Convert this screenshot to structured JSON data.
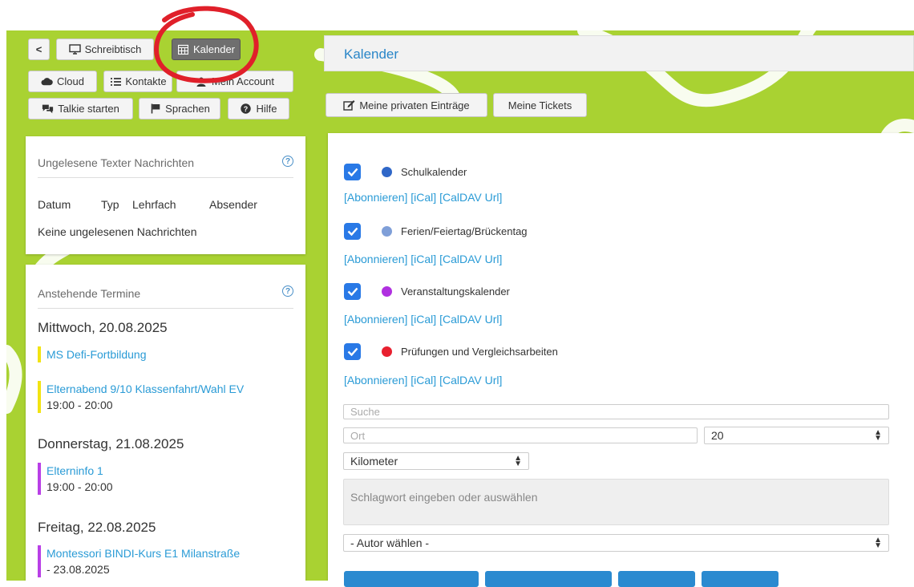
{
  "nav": {
    "back_label": "<",
    "desktop_label": "Schreibtisch",
    "calendar_label": "Kalender",
    "cloud_label": "Cloud",
    "contacts_label": "Kontakte",
    "account_label": "Mein Account",
    "talkie_label": "Talkie starten",
    "languages_label": "Sprachen",
    "help_label": "Hilfe"
  },
  "header": {
    "title": "Kalender"
  },
  "tabs": {
    "private_label": "Meine privaten Einträge",
    "tickets_label": "Meine Tickets"
  },
  "unread": {
    "title": "Ungelesene Texter Nachrichten",
    "columns": [
      "Datum",
      "Typ",
      "Lehrfach",
      "Absender"
    ],
    "empty": "Keine ungelesenen Nachrichten"
  },
  "upcoming": {
    "title": "Anstehende Termine",
    "days": [
      {
        "date": "Mittwoch, 20.08.2025",
        "events": [
          {
            "title": "MS Defi-Fortbildung",
            "time": "",
            "color": "#f2e312"
          },
          {
            "title": "Elternabend 9/10 Klassenfahrt/Wahl EV",
            "time": "19:00 - 20:00",
            "color": "#f2e312"
          }
        ]
      },
      {
        "date": "Donnerstag, 21.08.2025",
        "events": [
          {
            "title": "Elterninfo 1",
            "time": "19:00 - 20:00",
            "color": "#b93fe6"
          }
        ]
      },
      {
        "date": "Freitag, 22.08.2025",
        "events": [
          {
            "title": "Montessori BINDI-Kurs E1 Milanstraße",
            "time": "- 23.08.2025",
            "color": "#b93fe6"
          }
        ]
      }
    ]
  },
  "calendars": [
    {
      "name": "Schulkalender",
      "color": "#2f67c8",
      "checked": true
    },
    {
      "name": "Ferien/Feiertag/Brückentag",
      "color": "#7f9fd8",
      "checked": true
    },
    {
      "name": "Veranstaltungskalender",
      "color": "#b030e0",
      "checked": true
    },
    {
      "name": "Prüfungen und Vergleichsarbeiten",
      "color": "#e8202f",
      "checked": true
    }
  ],
  "calendar_links": "[Abonnieren] [iCal] [CalDAV Url]",
  "search": {
    "search_placeholder": "Suche",
    "place_placeholder": "Ort",
    "radius_value": "20",
    "unit_value": "Kilometer",
    "tags_placeholder": "Schlagwort eingeben oder auswählen",
    "author_value": "- Autor wählen -"
  },
  "colors": {
    "accent": "#2a9bd6",
    "background": "#a9d232",
    "highlight_circle": "#e0202a"
  }
}
